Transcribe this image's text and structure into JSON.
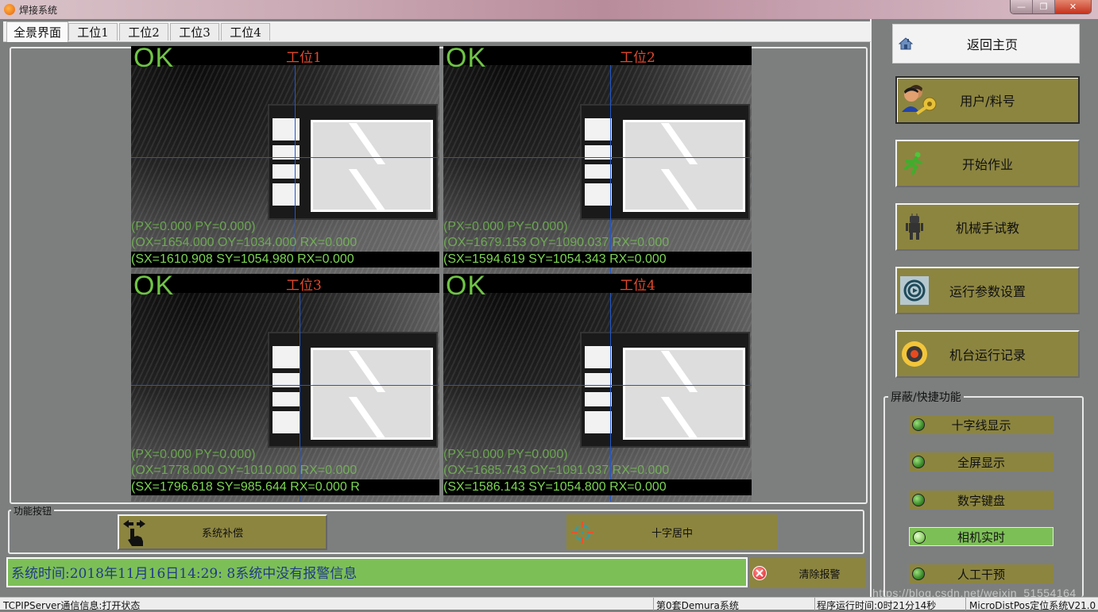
{
  "window": {
    "title": "焊接系统",
    "minimize": "—",
    "maximize": "❐",
    "close": "✕"
  },
  "tabs": [
    {
      "label": "全景界面",
      "active": true
    },
    {
      "label": "工位1",
      "active": false
    },
    {
      "label": "工位2",
      "active": false
    },
    {
      "label": "工位3",
      "active": false
    },
    {
      "label": "工位4",
      "active": false
    }
  ],
  "cameras": [
    {
      "title": "工位1",
      "result": "OK",
      "px_line": "(PX=0.000 PY=0.000)",
      "ox_line": "(OX=1654.000 OY=1034.000 RX=0.000",
      "sx_line": "(SX=1610.908 SY=1054.980 RX=0.000"
    },
    {
      "title": "工位2",
      "result": "OK",
      "px_line": "(PX=0.000 PY=0.000)",
      "ox_line": "(OX=1679.153 OY=1090.037 RX=0.000",
      "sx_line": "(SX=1594.619 SY=1054.343 RX=0.000"
    },
    {
      "title": "工位3",
      "result": "OK",
      "px_line": "(PX=0.000 PY=0.000)",
      "ox_line": "(OX=1778.000 OY=1010.000 RX=0.000",
      "sx_line": "(SX=1796.618 SY=985.644 RX=0.000 R"
    },
    {
      "title": "工位4",
      "result": "OK",
      "px_line": "(PX=0.000 PY=0.000)",
      "ox_line": "(OX=1685.743 OY=1091.037 RX=0.000",
      "sx_line": "(SX=1586.143 SY=1054.800 RX=0.000"
    }
  ],
  "function_group": {
    "label": "功能按钮",
    "compensate": "系统补偿",
    "center": "十字居中"
  },
  "status": {
    "message": "系统时间:2018年11月16日14:29: 8系统中没有报警信息",
    "clear_alarm": "清除报警"
  },
  "sidebar": {
    "home": "返回主页",
    "nav": [
      {
        "label": "用户/料号",
        "icon": "user-key-icon",
        "selected": true
      },
      {
        "label": "开始作业",
        "icon": "running-man-icon",
        "selected": false
      },
      {
        "label": "机械手试教",
        "icon": "robot-icon",
        "selected": false
      },
      {
        "label": "运行参数设置",
        "icon": "settings-dial-icon",
        "selected": false
      },
      {
        "label": "机台运行记录",
        "icon": "record-disc-icon",
        "selected": false
      }
    ],
    "shortcut_label": "屏蔽/快捷功能",
    "shortcuts": [
      {
        "label": "十字线显示",
        "on": false
      },
      {
        "label": "全屏显示",
        "on": false
      },
      {
        "label": "数字键盘",
        "on": false
      },
      {
        "label": "相机实时",
        "on": true
      },
      {
        "label": "人工干预",
        "on": false
      }
    ]
  },
  "statusbar": {
    "tcp": "TCPIPServer通信信息:打开状态",
    "system": "第0套Demura系统",
    "runtime": "程序运行时间:0时21分14秒",
    "version": "MicroDistPos定位系统V21.0"
  },
  "watermark": "https://blog.csdn.net/weixin_51554164"
}
